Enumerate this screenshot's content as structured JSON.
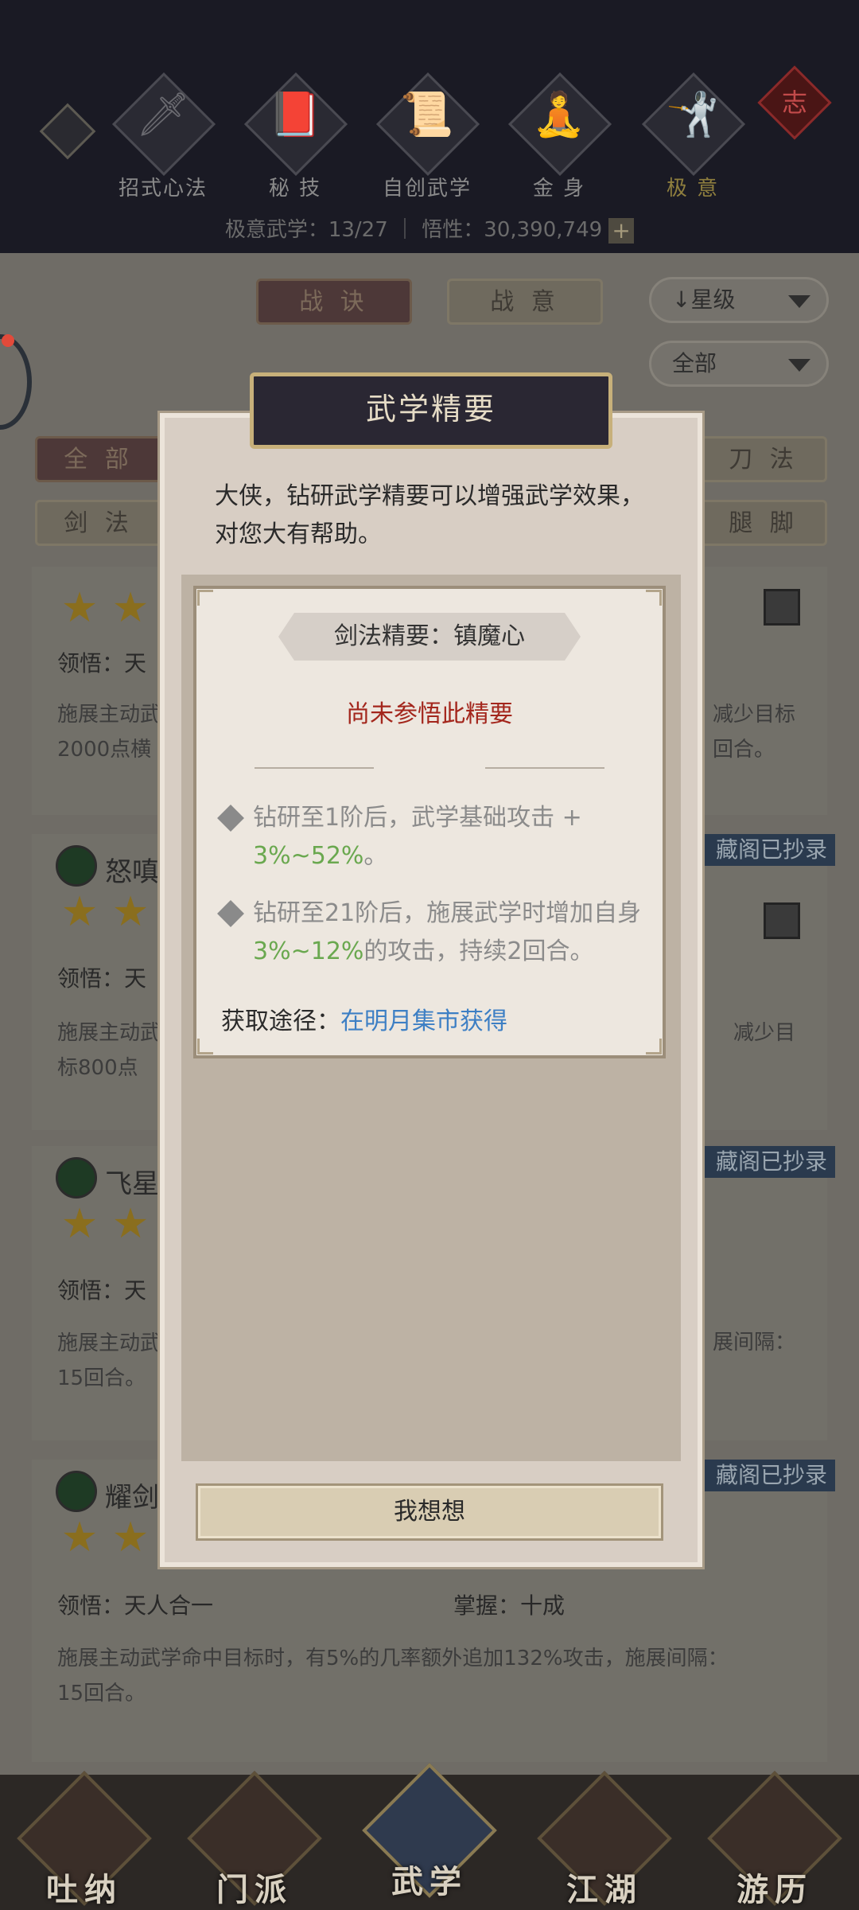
{
  "header": {
    "tabs": [
      {
        "label": "招式心法",
        "icon": "sword-icon"
      },
      {
        "label": "秘 技",
        "icon": "book-icon"
      },
      {
        "label": "自创武学",
        "icon": "scroll-icon"
      },
      {
        "label": "金 身",
        "icon": "meditation-icon"
      },
      {
        "label": "极 意",
        "icon": "martial-pose-icon",
        "active": true
      }
    ],
    "charm_text": "志",
    "stats": "极意武学：13/27 ｜ 悟性：30,390,749",
    "plus_symbol": "+"
  },
  "filters": {
    "zhanjue": "战 诀",
    "zhanyi": "战 意",
    "sort_label": "星级",
    "sort_arrow": "↓",
    "category_select": "全部",
    "type_all": "全 部",
    "type_sword": "剑 法",
    "type_blade": "刀 法",
    "type_leg": "腿 脚"
  },
  "cards": [
    {
      "name": "",
      "lingwu": "领悟：天",
      "desc": "施展主动武\n2000点横",
      "rdesc": "减少目标\n回合。"
    },
    {
      "name": "怒嗔",
      "lingwu": "领悟：天",
      "desc": "施展主动武\n标800点",
      "rdesc": "减少目\n",
      "badge": "藏阁已抄录"
    },
    {
      "name": "飞星",
      "lingwu": "领悟：天",
      "desc": "施展主动武\n15回合。",
      "rdesc": "展间隔：",
      "badge": "藏阁已抄录"
    },
    {
      "name": "耀剑",
      "lingwu": "领悟：天人合一",
      "mastery": "掌握：十成",
      "desc": "施展主动武学命中目标时，有5%的几率额外追加132%攻击，施展间隔：\n15回合。",
      "badge": "藏阁已抄录"
    }
  ],
  "modal": {
    "title": "武学精要",
    "intro": "大侠，钻研武学精要可以增强武学效果，对您大有帮助。",
    "subtitle": "剑法精要：镇魔心",
    "status": "尚未参悟此精要",
    "effect1_prefix": "钻研至1阶后，武学基础攻击 + ",
    "effect1_value": "3%~52%",
    "effect1_suffix": "。",
    "effect2_prefix": "钻研至21阶后，施展武学时增加自身",
    "effect2_value": "3%~12%",
    "effect2_suffix": "的攻击，持续2回合。",
    "source_label": "获取途径：",
    "source_link": "在明月集市获得",
    "button": "我想想"
  },
  "bottom_nav": [
    {
      "label": "吐纳"
    },
    {
      "label": "门派"
    },
    {
      "label": "武学",
      "active": true
    },
    {
      "label": "江湖"
    },
    {
      "label": "游历"
    }
  ]
}
